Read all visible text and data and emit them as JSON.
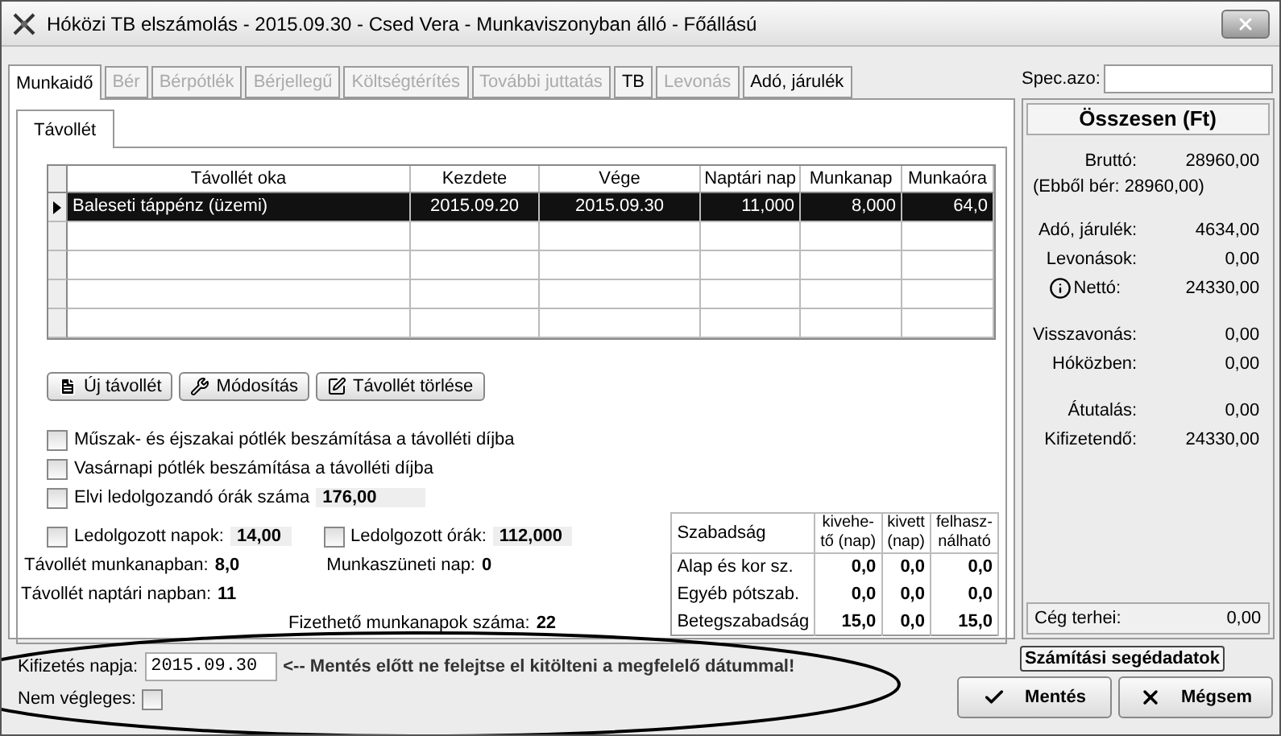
{
  "window": {
    "title": "Hóközi TB elszámolás - 2015.09.30 - Csed Vera - Munkaviszonyban álló - Főállású"
  },
  "tabs": [
    {
      "label": "Munkaidő",
      "selected": true,
      "disabled": false
    },
    {
      "label": "Bér",
      "selected": false,
      "disabled": true
    },
    {
      "label": "Bérpótlék",
      "selected": false,
      "disabled": true
    },
    {
      "label": "Bérjellegű",
      "selected": false,
      "disabled": true
    },
    {
      "label": "Költségtérítés",
      "selected": false,
      "disabled": true
    },
    {
      "label": "További juttatás",
      "selected": false,
      "disabled": true
    },
    {
      "label": "TB",
      "selected": false,
      "disabled": false
    },
    {
      "label": "Levonás",
      "selected": false,
      "disabled": true
    },
    {
      "label": "Adó, járulék",
      "selected": false,
      "disabled": false
    }
  ],
  "subtabs": [
    {
      "label": "Távollét",
      "selected": true
    }
  ],
  "absence_table": {
    "columns": [
      "Távollét oka",
      "Kezdete",
      "Vége",
      "Naptári nap",
      "Munkanap",
      "Munkaóra"
    ],
    "rows": [
      {
        "selected": true,
        "cells": [
          "Baleseti táppénz (üzemi)",
          "2015.09.20",
          "2015.09.30",
          "11,000",
          "8,000",
          "64,0"
        ]
      }
    ]
  },
  "actions": [
    {
      "label": "Új távollét",
      "kind": "new"
    },
    {
      "label": "Módosítás",
      "kind": "edit"
    },
    {
      "label": "Távollét törlése",
      "kind": "delete"
    }
  ],
  "options": [
    {
      "label": "Műszak- és éjszakai pótlék beszámítása a távolléti díjba",
      "checked": false
    },
    {
      "label": "Vasárnapi pótlék beszámítása a távolléti díjba",
      "checked": false
    },
    {
      "label": "Elvi ledolgozandó órák száma",
      "checked": false,
      "value": "176,00"
    }
  ],
  "worked": [
    {
      "label": "Ledolgozott napok:",
      "checked": false,
      "value": "14,00"
    },
    {
      "label": "Ledolgozott órák:",
      "checked": false,
      "value": "112,000"
    }
  ],
  "stats": [
    {
      "label": "Távollét munkanapban:",
      "value": "8,0"
    },
    {
      "label": "Munkaszüneti nap:",
      "value": "0"
    },
    {
      "label": "Távollét naptári napban:",
      "value": "11"
    },
    {
      "label": "Fizethető munkanapok száma:",
      "value": "22"
    }
  ],
  "leave_table": {
    "columns": [
      "Szabadság",
      "kivehe-\ntő (nap)",
      "kivett\n(nap)",
      "felhasz-\nnálható"
    ],
    "rows": [
      [
        "Alap és kor sz.",
        "0,0",
        "0,0",
        "0,0"
      ],
      [
        "Egyéb pótszab.",
        "0,0",
        "0,0",
        "0,0"
      ],
      [
        "Betegszabadság",
        "15,0",
        "0,0",
        "15,0"
      ]
    ]
  },
  "spec_field": {
    "label": "Spec.azo:"
  },
  "summary": {
    "title": "Összesen (Ft)",
    "groups": [
      [
        {
          "kind": "pair",
          "label": "Bruttó:",
          "value": "28960,00"
        },
        {
          "kind": "note",
          "label": "(Ebből bér: 28960,00)"
        }
      ],
      [
        {
          "kind": "pair",
          "label": "Adó, járulék:",
          "value": "4634,00"
        },
        {
          "kind": "pair",
          "label": "Levonások:",
          "value": "0,00"
        },
        {
          "kind": "info",
          "label": "Nettó:",
          "value": "24330,00"
        }
      ],
      [
        {
          "kind": "pair",
          "label": "Visszavonás:",
          "value": "0,00"
        },
        {
          "kind": "pair",
          "label": "Hóközben:",
          "value": "0,00"
        }
      ],
      [
        {
          "kind": "pair",
          "label": "Átutalás:",
          "value": "0,00"
        },
        {
          "kind": "pair",
          "label": "Kifizetendő:",
          "value": "24330,00"
        }
      ]
    ],
    "company": {
      "label": "Cég terhei:",
      "value": "0,00"
    }
  },
  "payment": {
    "label": "Kifizetés napja:",
    "value": "2015.09.30",
    "warning": "<-- Mentés előtt ne felejtse el kitölteni a megfelelő dátummal!"
  },
  "not_final": {
    "label": "Nem végleges:",
    "checked": false
  },
  "helper_button": "Számítási segédadatok",
  "buttons": [
    {
      "label": "Mentés",
      "kind": "save"
    },
    {
      "label": "Mégsem",
      "kind": "cancel"
    }
  ]
}
